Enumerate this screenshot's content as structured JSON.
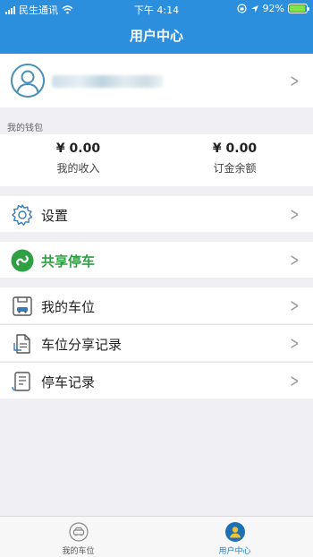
{
  "status_bar": {
    "carrier": "民生通讯",
    "time": "下午 4:14",
    "battery": "92%"
  },
  "nav": {
    "title": "用户中心"
  },
  "profile": {
    "name_hidden": true
  },
  "wallet": {
    "section_label": "我的钱包",
    "income": {
      "amount": "¥ 0.00",
      "label": "我的收入"
    },
    "deposit": {
      "amount": "¥ 0.00",
      "label": "订金余额"
    }
  },
  "menu": {
    "settings": "设置",
    "shared_parking": "共享停车",
    "my_spaces": "我的车位",
    "share_records": "车位分享记录",
    "parking_records": "停车记录"
  },
  "tabs": [
    {
      "label": "我的车位",
      "active": false
    },
    {
      "label": "用户中心",
      "active": true
    }
  ],
  "colors": {
    "brand": "#2b8fdd",
    "shared_green": "#2ea043",
    "tab_active": "#1f7fd1"
  }
}
